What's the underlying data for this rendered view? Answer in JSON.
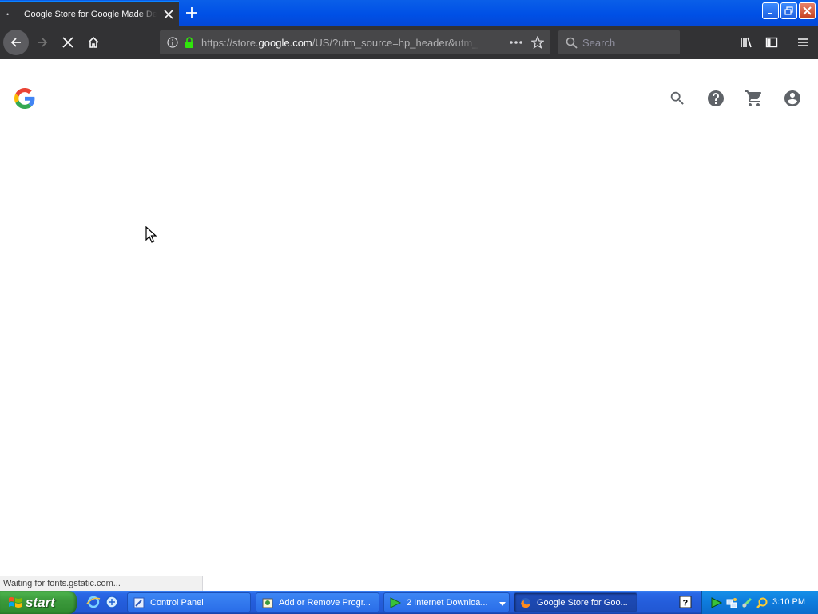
{
  "browser": {
    "tab": {
      "title": "Google Store for Google Made Devices",
      "close_icon": "close-icon"
    },
    "new_tab_icon": "plus-icon",
    "url": {
      "prefix": "https://store.",
      "domain": "google.com",
      "suffix": "/US/?utm_source=hp_header&utm_"
    },
    "search_placeholder": "Search",
    "status_text": "Waiting for fonts.gstatic.com..."
  },
  "page": {
    "header_icons": [
      "search-icon",
      "help-icon",
      "cart-icon",
      "account-icon"
    ]
  },
  "taskbar": {
    "start_label": "start",
    "tasks": [
      {
        "label": "Control Panel"
      },
      {
        "label": "Add or Remove Progr..."
      },
      {
        "label": "2 Internet Downloa..."
      },
      {
        "label": "Google Store for Goo..."
      }
    ],
    "clock": "3:10 PM"
  },
  "colors": {
    "tab_active_bg": "#323234",
    "titlebar_blue": "#0050e6",
    "taskbar_blue": "#245ddb",
    "start_green": "#3c9a3c"
  }
}
